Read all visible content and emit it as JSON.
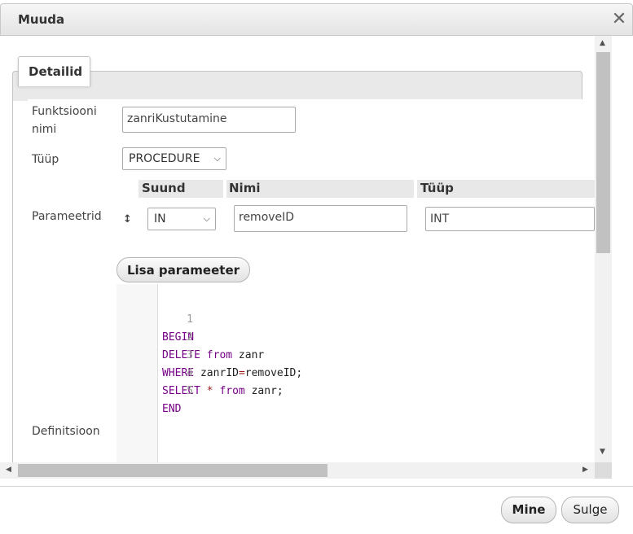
{
  "dialog": {
    "title": "Muuda",
    "close_symbol": "✕"
  },
  "tabs": [
    {
      "label": "Detailid"
    }
  ],
  "form": {
    "function_name_label": "Funktsiooni nimi",
    "function_name_value": "zanriKustutamine",
    "type_label": "Tüüp",
    "type_value": "PROCEDURE",
    "params_label": "Parameetrid",
    "params_headers": {
      "direction": "Suund",
      "name": "Nimi",
      "type": "Tüüp"
    },
    "params": [
      {
        "handle": "↕",
        "direction": "IN",
        "name": "removeID",
        "type": "INT"
      }
    ],
    "add_param_label": "Lisa parameeter",
    "definition_label": "Definitsioon"
  },
  "editor": {
    "lines": [
      {
        "num": "1",
        "text": "BEGIN"
      },
      {
        "num": "2",
        "text": "DELETE from zanr"
      },
      {
        "num": "3",
        "text": "WHERE zanrID=removeID;"
      },
      {
        "num": "4",
        "text": "SELECT * from zanr;"
      },
      {
        "num": "5",
        "text": "END"
      }
    ]
  },
  "footer": {
    "ok_label": "Mine",
    "close_label": "Sulge"
  },
  "icons": {
    "close": "close-icon",
    "drag": "drag-handle-icon",
    "dropdown": "chevron-down-icon",
    "scroll_up": "arrow-up-icon",
    "scroll_down": "arrow-down-icon",
    "scroll_left": "arrow-left-icon",
    "scroll_right": "arrow-right-icon"
  }
}
